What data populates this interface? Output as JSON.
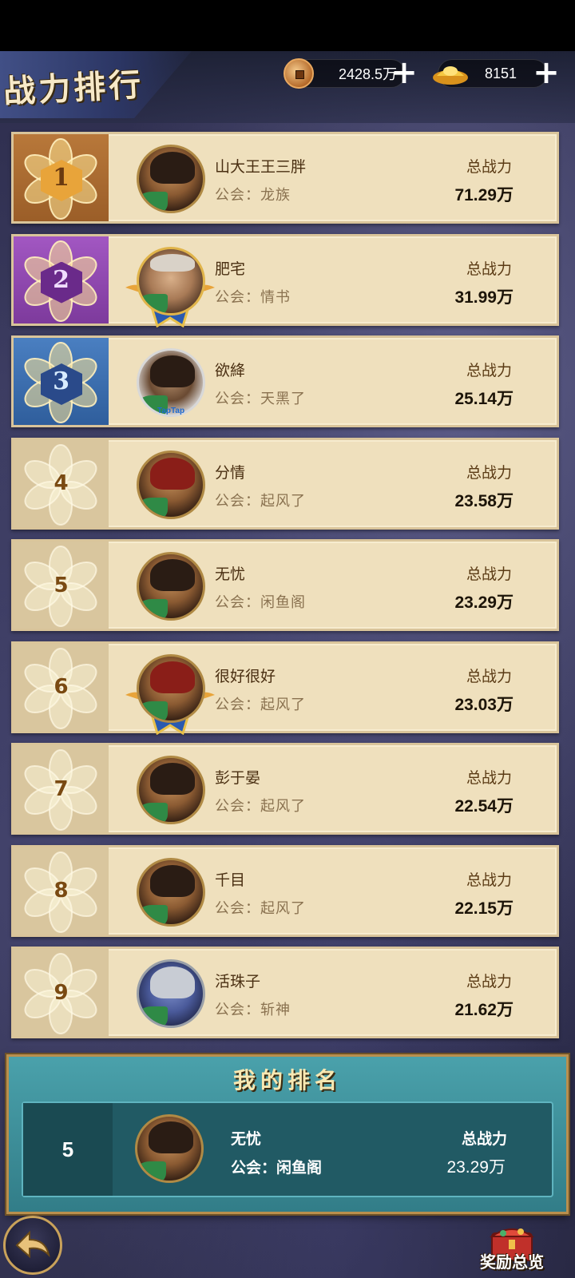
{
  "header": {
    "title": "战力排行",
    "copper": "2428.5万",
    "gold": "8151"
  },
  "ranking": [
    {
      "rank": "1",
      "name": "山大王王三胖",
      "guild": "公会：龙族",
      "power_label": "总战力",
      "power": "71.29万"
    },
    {
      "rank": "2",
      "name": "肥宅",
      "guild": "公会：情书",
      "power_label": "总战力",
      "power": "31.99万"
    },
    {
      "rank": "3",
      "name": "欲絳",
      "guild": "公会：天黑了",
      "power_label": "总战力",
      "power": "25.14万"
    },
    {
      "rank": "4",
      "name": "分情",
      "guild": "公会：起风了",
      "power_label": "总战力",
      "power": "23.58万"
    },
    {
      "rank": "5",
      "name": "无忧",
      "guild": "公会：闲鱼阁",
      "power_label": "总战力",
      "power": "23.29万"
    },
    {
      "rank": "6",
      "name": "很好很好",
      "guild": "公会：起风了",
      "power_label": "总战力",
      "power": "23.03万"
    },
    {
      "rank": "7",
      "name": "彭于晏",
      "guild": "公会：起风了",
      "power_label": "总战力",
      "power": "22.54万"
    },
    {
      "rank": "8",
      "name": "千目",
      "guild": "公会：起风了",
      "power_label": "总战力",
      "power": "22.15万"
    },
    {
      "rank": "9",
      "name": "活珠子",
      "guild": "公会：斩神",
      "power_label": "总战力",
      "power": "21.62万"
    }
  ],
  "taptap_label": "TapTap",
  "my_rank": {
    "title": "我的排名",
    "rank": "5",
    "name": "无忧",
    "guild": "公会：闲鱼阁",
    "power_label": "总战力",
    "power": "23.29万"
  },
  "footer": {
    "reward_label": "奖励总览"
  },
  "colors": {
    "gold": "#b8783a",
    "purple": "#a257c2",
    "blue": "#4a7fc1",
    "card": "#efe0bd",
    "panel": "#4aa1ab"
  }
}
